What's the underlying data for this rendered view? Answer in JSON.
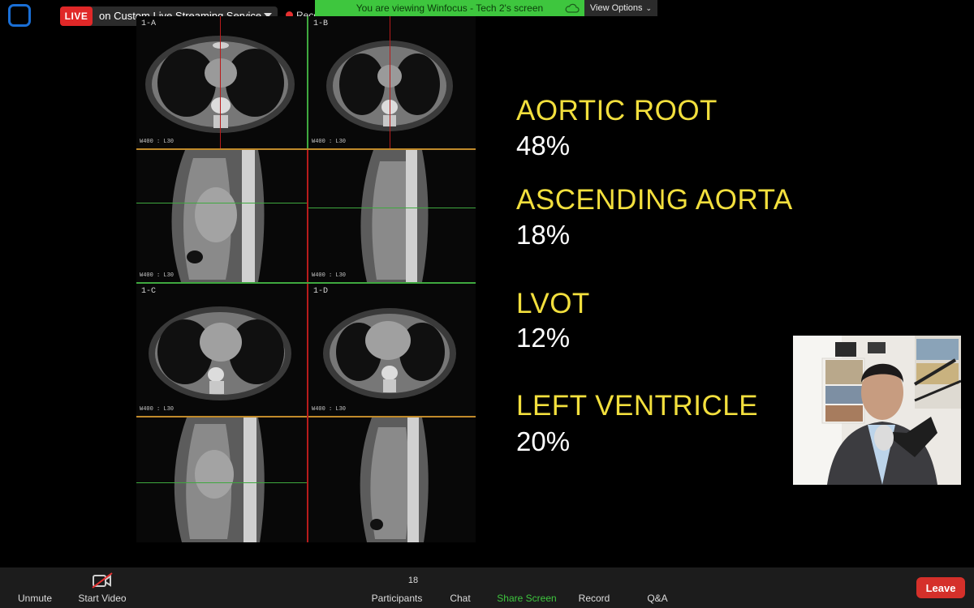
{
  "top_bar": {
    "live_badge": "LIVE",
    "live_label": "on Custom Live Streaming Service",
    "recording_label": "Recording",
    "banner": "You are viewing Winfocus - Tech 2's screen",
    "view_options": "View Options"
  },
  "ct_panels": {
    "p1a": {
      "label": "1-A",
      "wl": "W400 : L30"
    },
    "p1b": {
      "label": "1-B",
      "wl": "W400 : L30"
    },
    "p2a": {
      "wl": "W400 : L30"
    },
    "p2b": {
      "wl": "W400 : L30"
    },
    "p1c": {
      "label": "1-C",
      "wl": "W400 : L30"
    },
    "p1d": {
      "label": "1-D",
      "wl": "W400 : L30"
    }
  },
  "stats": [
    {
      "title": "AORTIC ROOT",
      "value": "48%"
    },
    {
      "title": "ASCENDING AORTA",
      "value": "18%"
    },
    {
      "title": "LVOT",
      "value": "12%"
    },
    {
      "title": "LEFT VENTRICLE",
      "value": "20%"
    }
  ],
  "toolbar": {
    "unmute": "Unmute",
    "start_video": "Start Video",
    "participants_count": "18",
    "participants": "Participants",
    "chat": "Chat",
    "share_screen": "Share Screen",
    "record": "Record",
    "qa": "Q&A",
    "leave": "Leave"
  },
  "colors": {
    "live_red": "#e02828",
    "banner_green": "#3ec63e",
    "stat_title_yellow": "#f2df3d",
    "share_green": "#3ec63e",
    "leave_red": "#d5302a"
  }
}
